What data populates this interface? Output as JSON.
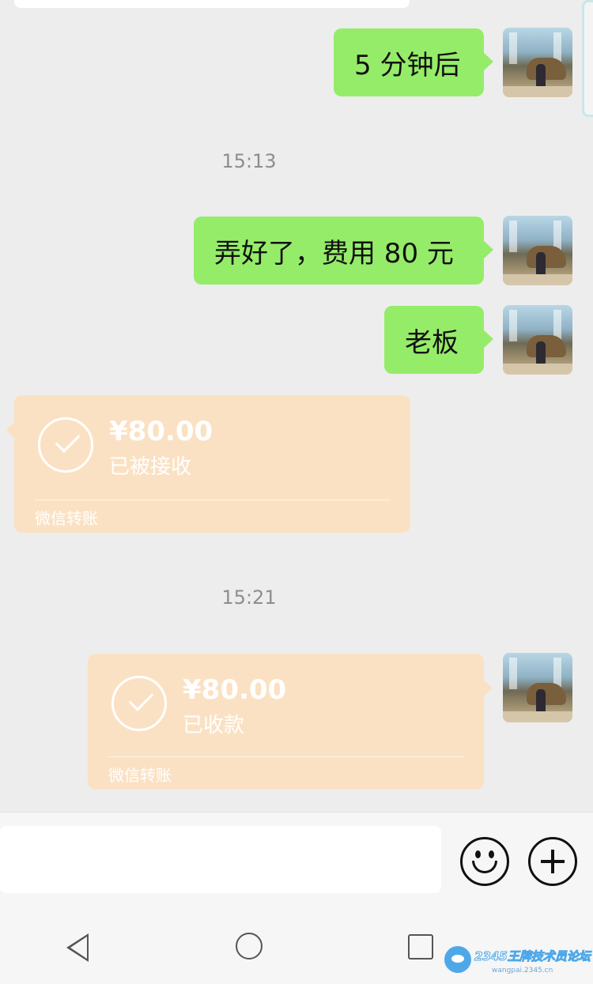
{
  "chat": {
    "messages": [
      {
        "text": "5 分钟后"
      },
      {
        "text": "弄好了，费用 80 元"
      },
      {
        "text": "老板"
      }
    ],
    "timestamps": [
      "15:13",
      "15:21"
    ],
    "transfers": [
      {
        "amount": "¥80.00",
        "status": "已被接收",
        "label": "微信转账"
      },
      {
        "amount": "¥80.00",
        "status": "已收款",
        "label": "微信转账"
      }
    ]
  },
  "input": {
    "emoji_icon": "smile-icon",
    "more_icon": "plus-icon"
  },
  "navbar": {
    "icons": [
      "back-icon",
      "home-icon",
      "recents-icon"
    ]
  },
  "watermark": {
    "text": "2345王牌技术员论坛",
    "sub": "wangpai.2345.cn"
  },
  "colors": {
    "sent_bubble": "#95ec69",
    "transfer_bubble": "#fbe1c3",
    "background": "#ededed"
  }
}
